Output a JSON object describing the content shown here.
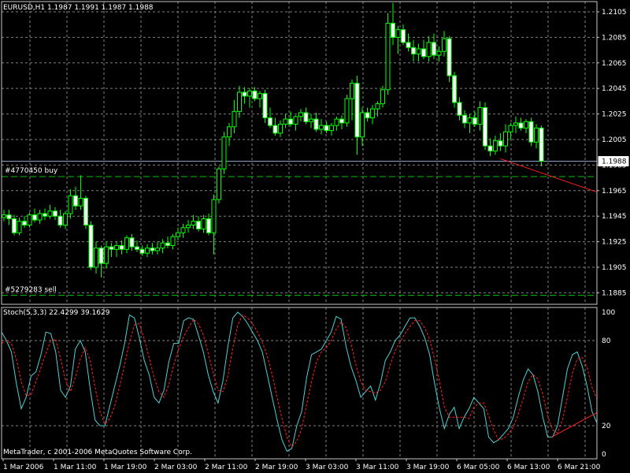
{
  "header": {
    "symbol_info": "EURUSD,H1  1.1987 1.1991 1.1987 1.1988"
  },
  "orders": [
    {
      "label": "#4770450 buy",
      "price": 1.1976
    },
    {
      "label": "#5279283 sell",
      "price": 1.1883
    }
  ],
  "indicator": {
    "title": "Stoch(5,3,3) 22.4299 39.1629",
    "levels": [
      20,
      80
    ]
  },
  "copyright": "MetaTrader, c 2001-2006 MetaQuotes Software Corp.",
  "colors": {
    "background": "#000000",
    "grid": "#7f7f7f",
    "bull_body": "#000000",
    "bull_outline": "#00ff00",
    "bear_body": "#ffffff",
    "main_line": "#4fd0d0",
    "signal_line": "#ff2020",
    "trend_line": "#ff2020",
    "bid_line": "#8aa0c0",
    "order_line": "#00c000",
    "text": "#ffffff"
  },
  "chart_data": [
    {
      "type": "candlestick",
      "title": "EURUSD,H1",
      "timeframe": "H1",
      "last_ohlc": {
        "open": 1.1987,
        "high": 1.1991,
        "low": 1.1987,
        "close": 1.1988
      },
      "current_price": "1.1988",
      "ylim": [
        1.1876,
        1.2113
      ],
      "y_ticks": [
        "1.2105",
        "1.2085",
        "1.2065",
        "1.2045",
        "1.2025",
        "1.2005",
        "1.1985",
        "1.1965",
        "1.1945",
        "1.1925",
        "1.1905",
        "1.1885"
      ],
      "x_ticks": [
        "1 Mar 2006",
        "1 Mar 11:00",
        "1 Mar 19:00",
        "2 Mar 03:00",
        "2 Mar 11:00",
        "2 Mar 19:00",
        "3 Mar 03:00",
        "3 Mar 11:00",
        "3 Mar 19:00",
        "6 Mar 05:00",
        "6 Mar 13:00",
        "6 Mar 21:00"
      ],
      "ohlc": [
        [
          1.1944,
          1.195,
          1.1941,
          1.1946
        ],
        [
          1.1946,
          1.195,
          1.1938,
          1.1943
        ],
        [
          1.1943,
          1.1946,
          1.193,
          1.1932
        ],
        [
          1.1932,
          1.1944,
          1.193,
          1.1941
        ],
        [
          1.1941,
          1.1945,
          1.1936,
          1.1938
        ],
        [
          1.1938,
          1.1948,
          1.1936,
          1.1946
        ],
        [
          1.1946,
          1.1951,
          1.194,
          1.1942
        ],
        [
          1.1942,
          1.195,
          1.1939,
          1.1947
        ],
        [
          1.1947,
          1.1951,
          1.1942,
          1.1945
        ],
        [
          1.1945,
          1.1954,
          1.1943,
          1.1949
        ],
        [
          1.1949,
          1.1952,
          1.1942,
          1.1945
        ],
        [
          1.1945,
          1.195,
          1.1936,
          1.1938
        ],
        [
          1.1938,
          1.1949,
          1.1935,
          1.1947
        ],
        [
          1.1947,
          1.1966,
          1.1943,
          1.1961
        ],
        [
          1.1961,
          1.1968,
          1.195,
          1.1953
        ],
        [
          1.1953,
          1.1977,
          1.195,
          1.1959
        ],
        [
          1.1959,
          1.1961,
          1.1935,
          1.1938
        ],
        [
          1.1938,
          1.1941,
          1.1903,
          1.1905
        ],
        [
          1.1905,
          1.1925,
          1.19,
          1.192
        ],
        [
          1.192,
          1.1922,
          1.1897,
          1.1908
        ],
        [
          1.1908,
          1.1925,
          1.1904,
          1.1921
        ],
        [
          1.1921,
          1.1924,
          1.1913,
          1.1919
        ],
        [
          1.1919,
          1.1925,
          1.1913,
          1.1922
        ],
        [
          1.1922,
          1.1926,
          1.1915,
          1.1919
        ],
        [
          1.1919,
          1.193,
          1.1916,
          1.1928
        ],
        [
          1.1928,
          1.1931,
          1.1918,
          1.1921
        ],
        [
          1.1921,
          1.1926,
          1.1917,
          1.1919
        ],
        [
          1.1919,
          1.1922,
          1.1914,
          1.1916
        ],
        [
          1.1916,
          1.1923,
          1.1913,
          1.192
        ],
        [
          1.192,
          1.1924,
          1.1915,
          1.1918
        ],
        [
          1.1918,
          1.1925,
          1.1915,
          1.192
        ],
        [
          1.192,
          1.1927,
          1.1916,
          1.1924
        ],
        [
          1.1924,
          1.1929,
          1.192,
          1.1922
        ],
        [
          1.1922,
          1.1931,
          1.1919,
          1.1929
        ],
        [
          1.1929,
          1.1936,
          1.1926,
          1.1932
        ],
        [
          1.1932,
          1.1939,
          1.1928,
          1.1936
        ],
        [
          1.1936,
          1.1942,
          1.1932,
          1.1938
        ],
        [
          1.1938,
          1.1946,
          1.1935,
          1.1941
        ],
        [
          1.1941,
          1.1945,
          1.1933,
          1.1935
        ],
        [
          1.1935,
          1.1946,
          1.1932,
          1.1943
        ],
        [
          1.1943,
          1.1947,
          1.193,
          1.1932
        ],
        [
          1.1932,
          1.1962,
          1.1915,
          1.1958
        ],
        [
          1.1958,
          1.1984,
          1.1955,
          1.1982
        ],
        [
          1.1982,
          1.2011,
          1.1978,
          1.2007
        ],
        [
          1.2007,
          1.2018,
          1.2,
          1.2015
        ],
        [
          1.2015,
          1.2036,
          1.201,
          1.2027
        ],
        [
          1.2027,
          1.2047,
          1.2022,
          1.2042
        ],
        [
          1.2042,
          1.2046,
          1.2033,
          1.2039
        ],
        [
          1.2039,
          1.2045,
          1.203,
          1.2043
        ],
        [
          1.2043,
          1.2046,
          1.2035,
          1.2037
        ],
        [
          1.2037,
          1.2043,
          1.203,
          1.2041
        ],
        [
          1.2041,
          1.2044,
          1.2018,
          1.2022
        ],
        [
          1.2022,
          1.203,
          1.2014,
          1.2016
        ],
        [
          1.2016,
          1.2022,
          1.2008,
          1.201
        ],
        [
          1.201,
          1.202,
          1.2007,
          1.2017
        ],
        [
          1.2017,
          1.2025,
          1.2014,
          1.2021
        ],
        [
          1.2021,
          1.2027,
          1.2015,
          1.2017
        ],
        [
          1.2017,
          1.2024,
          1.2012,
          1.2023
        ],
        [
          1.2023,
          1.2029,
          1.2019,
          1.2026
        ],
        [
          1.2026,
          1.203,
          1.2017,
          1.2019
        ],
        [
          1.2019,
          1.2025,
          1.2014,
          1.2021
        ],
        [
          1.2021,
          1.2026,
          1.2011,
          1.2013
        ],
        [
          1.2013,
          1.2021,
          1.2009,
          1.2016
        ],
        [
          1.2016,
          1.2019,
          1.201,
          1.2012
        ],
        [
          1.2012,
          1.2018,
          1.2008,
          1.2016
        ],
        [
          1.2016,
          1.2023,
          1.2012,
          1.2021
        ],
        [
          1.2021,
          1.2024,
          1.2013,
          1.2018
        ],
        [
          1.2018,
          1.204,
          1.2015,
          1.2037
        ],
        [
          1.2037,
          1.2052,
          1.202,
          1.2049
        ],
        [
          1.2049,
          1.2055,
          1.1993,
          1.2007
        ],
        [
          1.2007,
          1.203,
          1.2,
          1.2026
        ],
        [
          1.2026,
          1.203,
          1.2019,
          1.2022
        ],
        [
          1.2022,
          1.2032,
          1.2017,
          1.2029
        ],
        [
          1.2029,
          1.2035,
          1.2023,
          1.2033
        ],
        [
          1.2033,
          1.2047,
          1.203,
          1.2044
        ],
        [
          1.2044,
          1.2104,
          1.204,
          1.2096
        ],
        [
          1.2096,
          1.2112,
          1.2079,
          1.2085
        ],
        [
          1.2085,
          1.2094,
          1.2072,
          1.2091
        ],
        [
          1.2091,
          1.2095,
          1.2079,
          1.2081
        ],
        [
          1.2081,
          1.2088,
          1.2074,
          1.2077
        ],
        [
          1.2077,
          1.2083,
          1.2066,
          1.2072
        ],
        [
          1.2072,
          1.208,
          1.2066,
          1.2076
        ],
        [
          1.2076,
          1.2083,
          1.2068,
          1.207
        ],
        [
          1.207,
          1.2086,
          1.2066,
          1.2081
        ],
        [
          1.2081,
          1.2088,
          1.2068,
          1.2071
        ],
        [
          1.2071,
          1.2078,
          1.2066,
          1.2074
        ],
        [
          1.2074,
          1.209,
          1.207,
          1.2084
        ],
        [
          1.2084,
          1.2086,
          1.205,
          1.2055
        ],
        [
          1.2055,
          1.2058,
          1.203,
          1.2034
        ],
        [
          1.2034,
          1.2038,
          1.202,
          1.2024
        ],
        [
          1.2024,
          1.2028,
          1.2014,
          1.2018
        ],
        [
          1.2018,
          1.2025,
          1.201,
          1.2022
        ],
        [
          1.2022,
          1.2027,
          1.2015,
          1.2017
        ],
        [
          1.2017,
          1.2035,
          1.2012,
          1.203
        ],
        [
          1.203,
          1.2034,
          1.1997,
          1.2
        ],
        [
          1.2,
          1.2006,
          1.1992,
          1.1996
        ],
        [
          1.1996,
          1.2008,
          1.1993,
          1.2004
        ],
        [
          1.2004,
          1.201,
          1.1996,
          1.2
        ],
        [
          1.2,
          1.2017,
          1.1995,
          1.2011
        ],
        [
          1.2011,
          1.2018,
          1.2005,
          1.2016
        ],
        [
          1.2016,
          1.2023,
          1.201,
          1.2018
        ],
        [
          1.2018,
          1.2022,
          1.2012,
          1.2014
        ],
        [
          1.2014,
          1.2021,
          1.201,
          1.2019
        ],
        [
          1.2019,
          1.2022,
          1.2,
          1.2003
        ],
        [
          1.2003,
          1.2017,
          1.1998,
          1.2014
        ],
        [
          1.2014,
          1.2016,
          1.1984,
          1.1988
        ]
      ],
      "trend_line": {
        "from_index": 97,
        "from_price": 1.199,
        "to_index": 111,
        "to_price": 1.197
      }
    },
    {
      "type": "line",
      "title": "Stoch(5,3,3)",
      "ylim": [
        0,
        100
      ],
      "y_ticks": [
        "100",
        "80",
        "20",
        "0"
      ],
      "levels": [
        20,
        80
      ],
      "series": [
        {
          "name": "main",
          "values": [
            86,
            80,
            72,
            50,
            32,
            40,
            55,
            58,
            70,
            86,
            85,
            72,
            45,
            40,
            48,
            74,
            80,
            72,
            46,
            24,
            20,
            20,
            34,
            48,
            62,
            78,
            98,
            96,
            82,
            66,
            56,
            40,
            36,
            45,
            65,
            78,
            78,
            94,
            96,
            95,
            84,
            72,
            56,
            44,
            36,
            52,
            76,
            96,
            100,
            97,
            92,
            86,
            80,
            72,
            56,
            40,
            24,
            10,
            2,
            4,
            20,
            30,
            54,
            70,
            72,
            74,
            80,
            86,
            97,
            95,
            76,
            62,
            52,
            40,
            44,
            48,
            38,
            50,
            66,
            72,
            80,
            84,
            90,
            96,
            96,
            90,
            82,
            70,
            50,
            32,
            18,
            28,
            33,
            18,
            26,
            32,
            40,
            36,
            32,
            12,
            8,
            10,
            14,
            18,
            26,
            40,
            52,
            60,
            56,
            44,
            26,
            12,
            12,
            20,
            40,
            60,
            70,
            72,
            62,
            48,
            30,
            22
          ]
        },
        {
          "name": "signal",
          "values": [
            78,
            80,
            78,
            67,
            51,
            41,
            42,
            51,
            61,
            71,
            80,
            81,
            67,
            52,
            44,
            54,
            67,
            75,
            66,
            47,
            30,
            21,
            25,
            34,
            48,
            63,
            79,
            91,
            92,
            81,
            68,
            54,
            44,
            40,
            49,
            63,
            74,
            83,
            89,
            95,
            92,
            84,
            71,
            57,
            45,
            44,
            55,
            75,
            91,
            98,
            96,
            92,
            86,
            79,
            69,
            56,
            40,
            25,
            12,
            5,
            9,
            18,
            35,
            51,
            65,
            72,
            75,
            80,
            88,
            93,
            89,
            78,
            63,
            51,
            45,
            44,
            43,
            45,
            51,
            63,
            73,
            79,
            85,
            90,
            94,
            94,
            89,
            81,
            67,
            51,
            33,
            26,
            26,
            26,
            26,
            25,
            33,
            36,
            36,
            27,
            17,
            10,
            11,
            14,
            19,
            28,
            39,
            51,
            56,
            53,
            42,
            27,
            17,
            15,
            24,
            40,
            57,
            67,
            68,
            61,
            47,
            39
          ]
        }
      ],
      "trend_line": {
        "from_index": 97,
        "from_value": 12,
        "to_index": 111,
        "to_value": 27
      }
    }
  ]
}
